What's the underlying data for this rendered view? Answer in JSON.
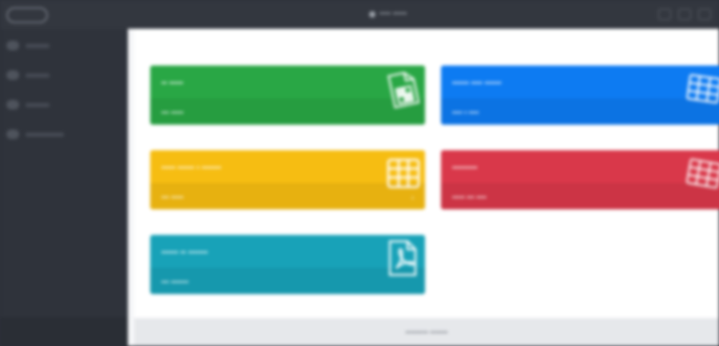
{
  "header": {
    "title": "•••• •••••"
  },
  "sidebar": {
    "items": [
      {
        "icon": "dashboard-icon"
      },
      {
        "icon": "folder-icon"
      },
      {
        "icon": "chart-icon"
      },
      {
        "icon": "settings-icon"
      }
    ]
  },
  "cards": {
    "green": {
      "title": "•• •••••",
      "footer": "••• •••••",
      "icon": "spreadsheet-file-icon",
      "color": "#29a745"
    },
    "blue": {
      "title": "•••••• •••• ••••••",
      "footer": "•••• • ••••",
      "icon": "table-icon",
      "color": "#0d7bf2"
    },
    "yellow": {
      "title": "••••• •••••• • •••••••",
      "footer": "••• •••••",
      "icon": "table-icon",
      "color": "#f6bd12"
    },
    "red": {
      "title": "•••••••••",
      "footer": "••••• ••• ••••",
      "icon": "table-icon",
      "color": "#d9384a"
    },
    "teal": {
      "title": "•••••• •• •••••••",
      "footer": "••• •••••••",
      "icon": "pdf-file-icon",
      "color": "#18a2b8"
    }
  },
  "footer": {
    "text": "••••••••• •••••••"
  }
}
